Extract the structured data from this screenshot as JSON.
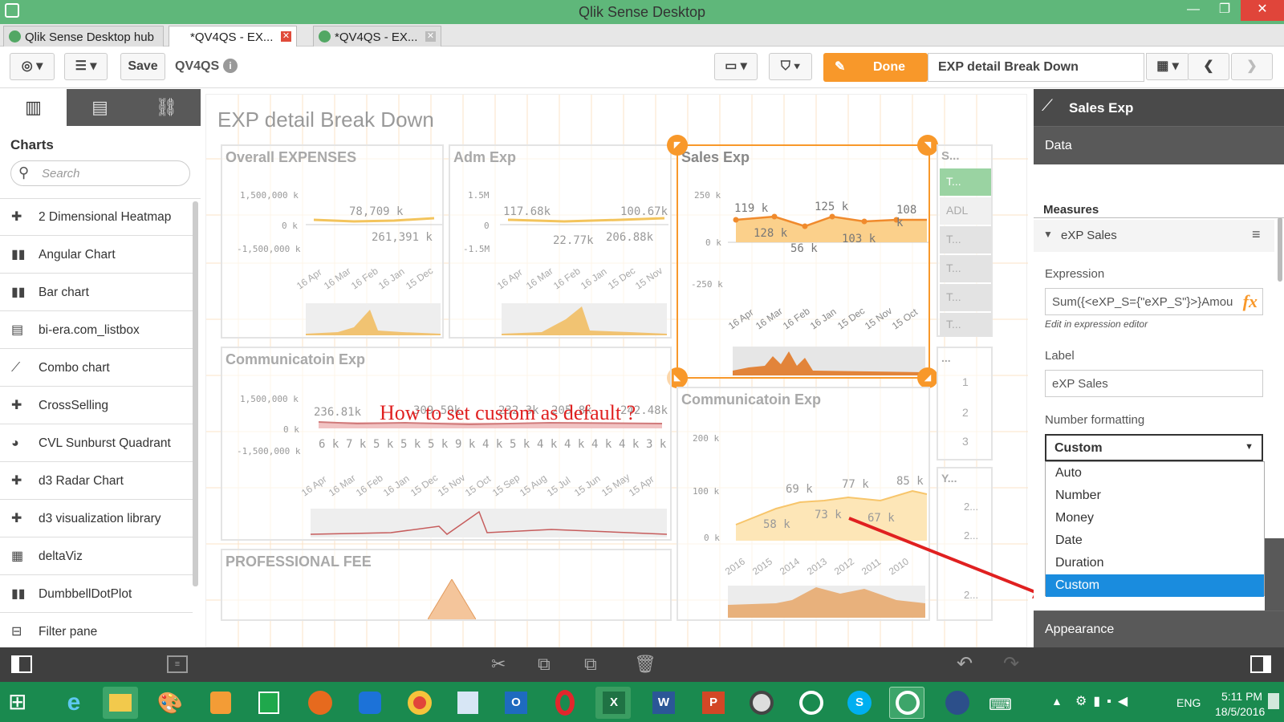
{
  "window": {
    "title": "Qlik Sense Desktop"
  },
  "tabs": [
    {
      "label": "Qlik Sense Desktop hub",
      "active": false,
      "closable": false
    },
    {
      "label": "*QV4QS - EX...",
      "active": true,
      "closable": true
    },
    {
      "label": "*QV4QS - EX...",
      "active": false,
      "closable": true
    }
  ],
  "toolbar": {
    "save_label": "Save",
    "app_name": "QV4QS",
    "done_label": "Done",
    "sheet_title": "EXP detail Break Down"
  },
  "left_panel": {
    "section_title": "Charts",
    "search_placeholder": "Search",
    "items": [
      {
        "label": "2 Dimensional Heatmap",
        "icon": "puzzle-icon"
      },
      {
        "label": "Angular Chart",
        "icon": "bar-chart-icon"
      },
      {
        "label": "Bar chart",
        "icon": "bar-chart-icon"
      },
      {
        "label": "bi-era.com_listbox",
        "icon": "list-icon"
      },
      {
        "label": "Combo chart",
        "icon": "combo-chart-icon"
      },
      {
        "label": "CrossSelling",
        "icon": "puzzle-icon"
      },
      {
        "label": "CVL Sunburst Quadrant",
        "icon": "pie-icon"
      },
      {
        "label": "d3 Radar Chart",
        "icon": "puzzle-icon"
      },
      {
        "label": "d3 visualization library",
        "icon": "puzzle-icon"
      },
      {
        "label": "deltaViz",
        "icon": "grid-icon"
      },
      {
        "label": "DumbbellDotPlot",
        "icon": "bar-chart-icon"
      },
      {
        "label": "Filter pane",
        "icon": "filter-icon"
      }
    ]
  },
  "sheet": {
    "title": "EXP detail Break Down",
    "annotation": "How to set custom as default ?",
    "cards": {
      "overall": {
        "title": "Overall EXPENSES",
        "y_ticks": [
          "1,500,000 k",
          "0 k",
          "-1,500,000 k"
        ],
        "labels": [
          "78,709 k",
          "261,391 k"
        ],
        "x_ticks": [
          "16 Apr",
          "16 Mar",
          "16 Feb",
          "16 Jan",
          "15 Dec"
        ]
      },
      "adm": {
        "title": "Adm Exp",
        "y_ticks": [
          "1.5M",
          "0",
          "-1.5M"
        ],
        "labels": [
          "117.68k",
          "100.67k",
          "22.77k",
          "206.88k"
        ],
        "x_ticks": [
          "16 Apr",
          "16 Mar",
          "16 Feb",
          "16 Jan",
          "15 Dec",
          "15 Nov"
        ]
      },
      "sales": {
        "title": "Sales Exp",
        "y_ticks": [
          "250 k",
          "0 k",
          "-250 k"
        ],
        "labels": [
          "119 k",
          "128 k",
          "56 k",
          "125 k",
          "103 k",
          "108 k"
        ],
        "x_ticks": [
          "16 Apr",
          "16 Mar",
          "16 Feb",
          "16 Jan",
          "15 Dec",
          "15 Nov",
          "15 Oct"
        ]
      },
      "filter": {
        "title": "S...",
        "items": [
          "T...",
          "ADL",
          "T...",
          "T...",
          "T...",
          "T..."
        ]
      },
      "comm1": {
        "title": "Communicatoin Exp",
        "y_ticks": [
          "1,500,000 k",
          "0 k",
          "-1,500,000 k"
        ],
        "labels": [
          "236.81k",
          "309.59k",
          "232.3k",
          "205.8k",
          "242.48k"
        ],
        "values": [
          "6 k",
          "7 k",
          "5 k",
          "5 k",
          "5 k",
          "9 k",
          "4 k",
          "5 k",
          "4 k",
          "4 k",
          "4 k",
          "4 k",
          "3 k"
        ],
        "x_ticks": [
          "16 Apr",
          "16 Mar",
          "16 Feb",
          "16 Jan",
          "15 Dec",
          "15 Nov",
          "15 Oct",
          "15 Sep",
          "15 Aug",
          "15 Jul",
          "15 Jun",
          "15 May",
          "15 Apr"
        ]
      },
      "table": {
        "title": "...",
        "rows": [
          "1",
          "2",
          "3"
        ]
      },
      "comm2": {
        "title": "Communicatoin Exp",
        "y_ticks": [
          "200 k",
          "100 k",
          "0 k"
        ],
        "labels": [
          "69 k",
          "77 k",
          "85 k",
          "58 k",
          "73 k",
          "67 k"
        ],
        "x_ticks": [
          "2016",
          "2015",
          "2014",
          "2013",
          "2012",
          "2011",
          "2010"
        ]
      },
      "y": {
        "title": "Y...",
        "rows": [
          "2...",
          "2...",
          "2..."
        ]
      },
      "prof": {
        "title": "PROFESSIONAL FEE"
      }
    }
  },
  "right_panel": {
    "title": "Sales Exp",
    "data_label": "Data",
    "measures_label": "Measures",
    "measure_name": "eXP Sales",
    "expression_label": "Expression",
    "expression_value": "Sum({<eXP_S={\"eXP_S\"}>}Amou",
    "fx_label": "fx",
    "edit_hint": "Edit in expression editor",
    "label_label": "Label",
    "label_value": "eXP Sales",
    "number_formatting_label": "Number formatting",
    "number_formatting_value": "Custom",
    "options": [
      "Auto",
      "Number",
      "Money",
      "Date",
      "Duration",
      "Custom"
    ],
    "selected_option": "Custom",
    "appearance_label": "Appearance"
  },
  "taskbar": {
    "language": "ENG",
    "time": "5:11 PM",
    "date": "18/5/2016"
  },
  "colors": {
    "accent": "#f8982a",
    "qlik_green": "#52a764",
    "selected": "#1a8cde",
    "annotation": "#e02020"
  }
}
